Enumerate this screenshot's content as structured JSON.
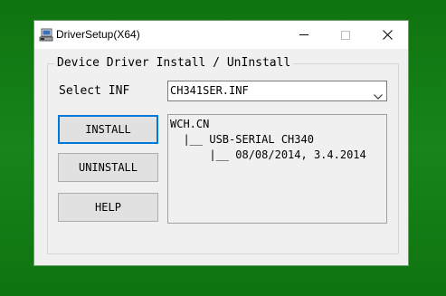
{
  "window": {
    "title": "DriverSetup(X64)"
  },
  "group": {
    "legend": "Device Driver Install / UnInstall"
  },
  "inf": {
    "label": "Select INF",
    "selected": "CH341SER.INF"
  },
  "buttons": {
    "install": "INSTALL",
    "uninstall": "UNINSTALL",
    "help": "HELP"
  },
  "info": {
    "lines": [
      "WCH.CN",
      "  |__ USB-SERIAL CH340",
      "      |__ 08/08/2014, 3.4.2014"
    ]
  },
  "icons": {
    "app": "computer-installer-icon",
    "minimize": "minimize-icon",
    "maximize": "maximize-icon",
    "close": "close-icon",
    "dropdown": "chevron-down-icon"
  },
  "colors": {
    "desktop": "#127a12",
    "window_bg": "#f0f0f0",
    "default_button_border": "#0078d7"
  }
}
